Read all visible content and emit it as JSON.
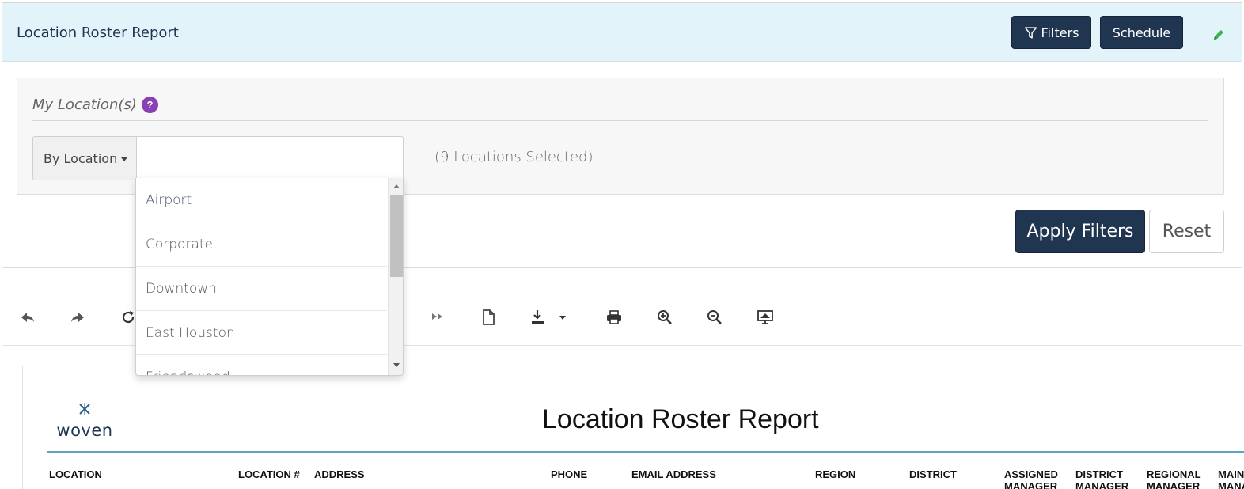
{
  "header": {
    "title": "Location Roster Report",
    "filters_label": "Filters",
    "schedule_label": "Schedule"
  },
  "filter_panel": {
    "heading": "My Location(s)",
    "help_label": "?",
    "mode_label": "By Location",
    "search_value": "",
    "selected_count": "(9 Locations Selected)"
  },
  "dropdown": {
    "items": [
      "Airport",
      "Corporate",
      "Downtown",
      "East Houston",
      "Friendswood"
    ]
  },
  "actions": {
    "apply_label": "Apply Filters",
    "reset_label": "Reset"
  },
  "toolbar": {
    "icons": [
      "undo-icon",
      "redo-icon",
      "refresh-icon",
      "last-page-icon",
      "new-page-icon",
      "download-icon",
      "print-icon",
      "zoom-in-icon",
      "zoom-out-icon",
      "presentation-icon"
    ]
  },
  "report": {
    "logo_text": "woven",
    "title": "Location Roster Report",
    "columns": [
      "LOCATION",
      "LOCATION #",
      "ADDRESS",
      "PHONE",
      "EMAIL ADDRESS",
      "REGION",
      "DISTRICT",
      "ASSIGNED MANAGER",
      "DISTRICT MANAGER",
      "REGIONAL MANAGER",
      "MAINT. MANAGER"
    ]
  },
  "colors": {
    "primary": "#1f3550",
    "header_bg": "#e2f3fa",
    "help_badge": "#8a3fb3",
    "edit_icon": "#3bb54a",
    "report_rule": "#5ba3c0"
  }
}
